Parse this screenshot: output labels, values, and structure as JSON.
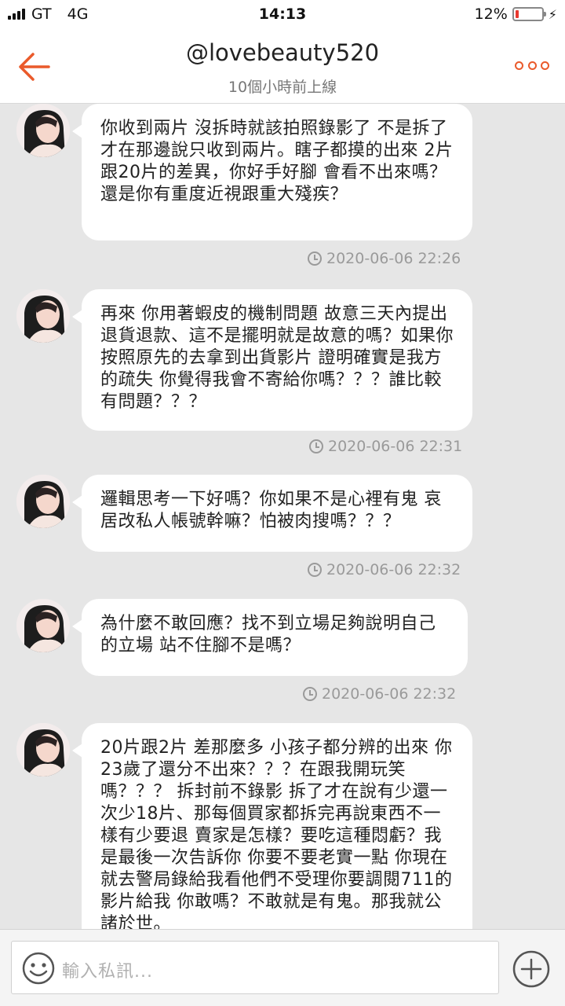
{
  "status_bar": {
    "carrier": "GT",
    "network": "4G",
    "time": "14:13",
    "battery": "12%",
    "battery_level": 0.12
  },
  "header": {
    "title": "@lovebeauty520",
    "subtitle": "10個小時前上線",
    "back_icon": "back-arrow-icon",
    "more_icon": "more-dots-icon",
    "accent_color": "#ea5a2b"
  },
  "messages": [
    {
      "text": "你收到兩片 沒拆時就該拍照錄影了 不是拆了才在那邊說只收到兩片。瞎子都摸的出來 2片跟20片的差異，你好手好腳 會看不出來嗎？還是你有重度近視跟重大殘疾？",
      "time": "2020-06-06 22:26"
    },
    {
      "text": "再來 你用著蝦皮的機制問題 故意三天內提出退貨退款、這不是擺明就是故意的嗎？如果你按照原先的去拿到出貨影片 證明確實是我方的疏失 你覺得我會不寄給你嗎？？？誰比較有問題？？？",
      "time": "2020-06-06 22:31"
    },
    {
      "text": "邏輯思考一下好嗎？你如果不是心裡有鬼 哀居改私人帳號幹嘛？怕被肉搜嗎？？？",
      "time": "2020-06-06 22:32"
    },
    {
      "text": "為什麼不敢回應？找不到立場足夠說明自己的立場 站不住腳不是嗎？",
      "time": "2020-06-06 22:32"
    },
    {
      "text": "20片跟2片 差那麼多 小孩子都分辨的出來 你23歲了還分不出來？？？在跟我開玩笑嗎？？？ 拆封前不錄影 拆了才在說有少還一次少18片、那每個買家都拆完再說東西不一樣有少要退 賣家是怎樣？要吃這種悶虧？我是最後一次告訴你 你要不要老實一點 你現在就去警局錄給我看他們不受理你要調閱711的影片給我 你敢嗎？不敢就是有鬼。那我就公諸於世。",
      "time": ""
    }
  ],
  "input": {
    "placeholder": "輸入私訊...",
    "emoji_icon": "emoji-icon",
    "plus_icon": "plus-circle-icon"
  }
}
